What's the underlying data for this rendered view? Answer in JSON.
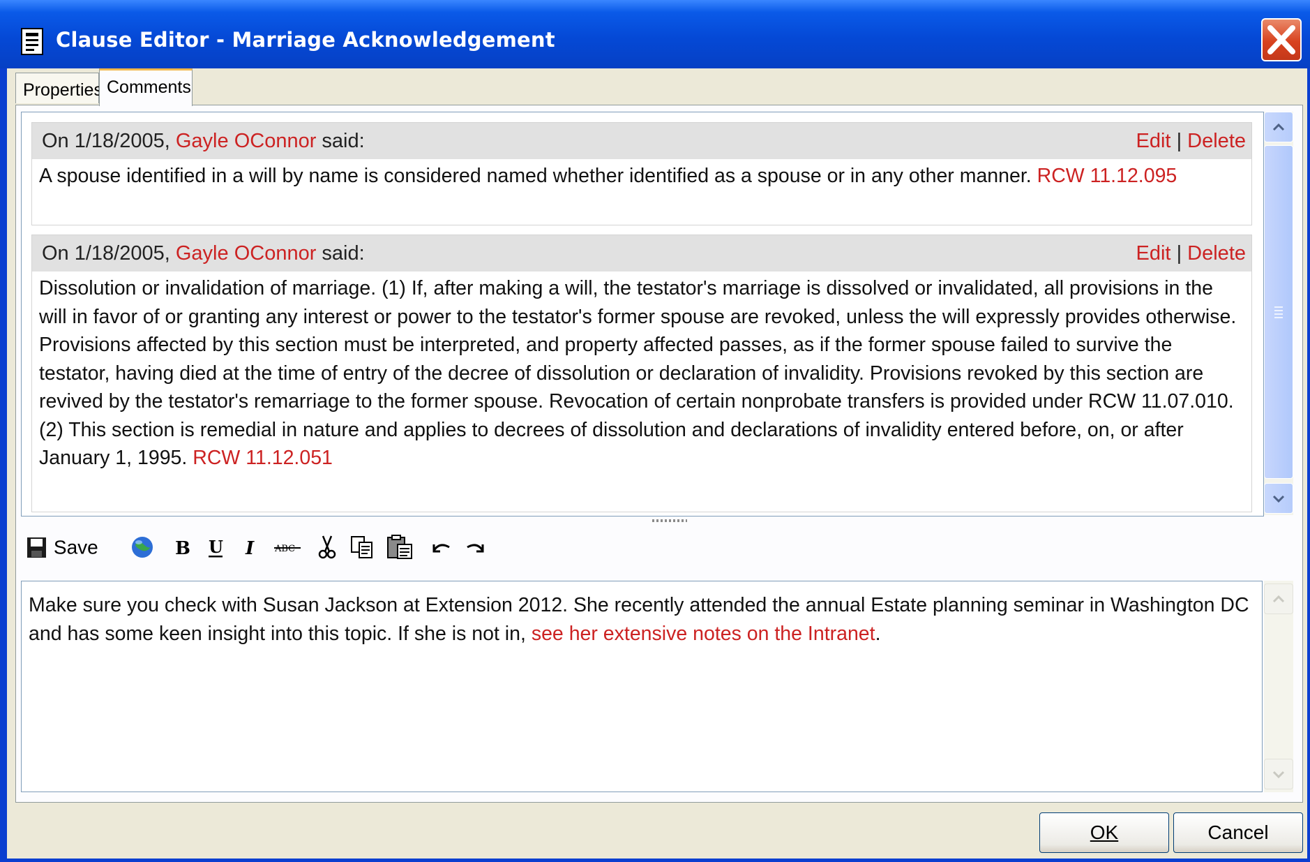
{
  "window": {
    "title": "Clause Editor - Marriage Acknowledgement"
  },
  "tabs": [
    {
      "label": "Properties"
    },
    {
      "label": "Comments"
    }
  ],
  "comments": [
    {
      "prefix": "On 1/18/2005, ",
      "author": "Gayle OConnor",
      "suffix": " said:",
      "edit": "Edit",
      "separator": "|",
      "delete": "Delete",
      "text": "A spouse identified in a will by name is considered named whether identified as a spouse or in any other manner.",
      "ref": "RCW 11.12.095"
    },
    {
      "prefix": "On 1/18/2005, ",
      "author": "Gayle OConnor",
      "suffix": " said:",
      "edit": "Edit",
      "separator": "|",
      "delete": "Delete",
      "text": "Dissolution or invalidation of marriage. (1) If, after making a will, the testator's marriage is dissolved or invalidated, all provisions in the will in favor of or granting any interest or power to the testator's former spouse are revoked, unless the will expressly provides otherwise. Provisions affected by this section must be interpreted, and property affected passes, as if the former spouse failed to survive the testator, having died at the time of entry of the decree of dissolution or declaration of invalidity. Provisions revoked by this section are revived by the testator's remarriage to the former spouse. Revocation of certain nonprobate transfers is provided under RCW 11.07.010. (2) This section is remedial in nature and applies to decrees of dissolution and declarations of invalidity entered before, on, or after January 1, 1995.",
      "ref": "RCW 11.12.051"
    }
  ],
  "toolbar": {
    "save_label": "Save",
    "icons": [
      "save-icon",
      "globe-link-icon",
      "bold-icon",
      "underline-icon",
      "italic-icon",
      "strikethrough-icon",
      "cut-icon",
      "copy-icon",
      "paste-icon",
      "undo-icon",
      "redo-icon"
    ]
  },
  "editor": {
    "text": "Make sure you check with Susan Jackson at Extension 2012. She recently attended the annual Estate planning seminar in Washington DC and has some keen insight into this topic. If she is not in,",
    "link": "see her extensive notes on the Intranet",
    "end": "."
  },
  "buttons": {
    "ok": "OK",
    "cancel": "Cancel"
  },
  "colors": {
    "title_bar": "#0549d6",
    "link_red": "#cc2222",
    "dialog_bg": "#ece9d8",
    "close_red": "#d8421e"
  }
}
